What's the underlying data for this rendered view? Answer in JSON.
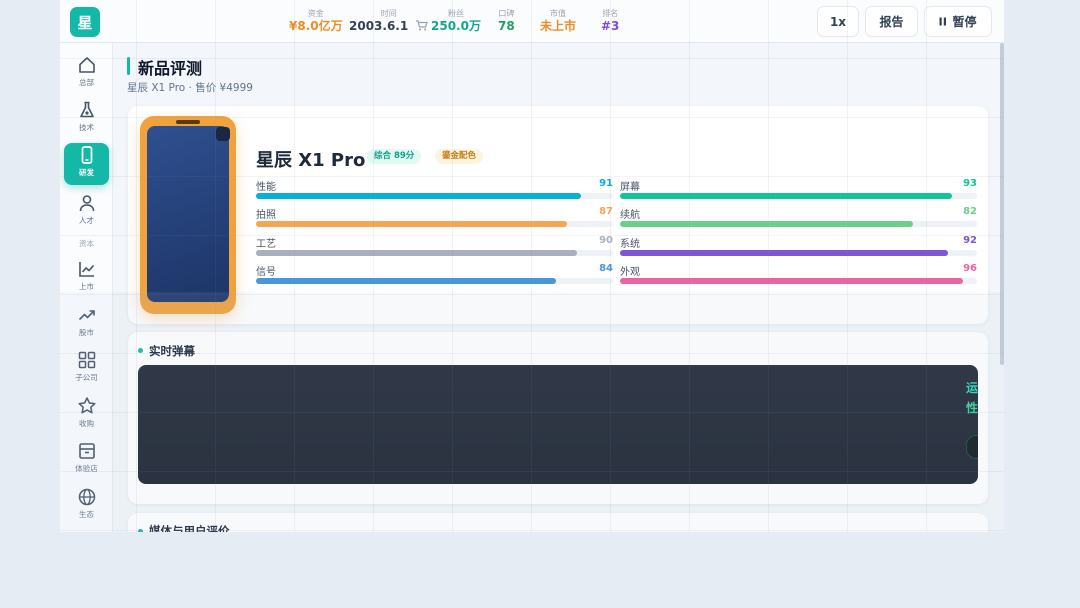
{
  "app": {
    "logo": "星"
  },
  "topbar": {
    "stats": [
      {
        "label": "资金",
        "value": "¥8.0亿万",
        "color": "#f08c24"
      },
      {
        "label": "时间",
        "value": "2003.6.1",
        "color": "#334155"
      },
      {
        "label": "粉丝",
        "value": "250.0万",
        "color": "#14a58f"
      },
      {
        "label": "口碑",
        "value": "78",
        "color": "#22a061"
      },
      {
        "label": "市值",
        "value": "未上市",
        "color": "#f08c24"
      },
      {
        "label": "排名",
        "value": "#3",
        "color": "#7c4ddb"
      }
    ],
    "speed": "1x",
    "report": "报告",
    "pause": "暂停"
  },
  "sidebar": {
    "items": [
      {
        "label": "总部",
        "icon": "home-icon"
      },
      {
        "label": "技术",
        "icon": "flask-icon"
      },
      {
        "label": "研发",
        "icon": "phone-icon",
        "active": true
      },
      {
        "label": "人才",
        "icon": "person-icon"
      },
      {
        "label": "上市",
        "icon": "chart-icon"
      },
      {
        "label": "股市",
        "icon": "trend-icon"
      },
      {
        "label": "子公司",
        "icon": "grid-icon"
      },
      {
        "label": "收购",
        "icon": "star-icon"
      },
      {
        "label": "体验店",
        "icon": "store-icon"
      },
      {
        "label": "生态",
        "icon": "globe-icon"
      }
    ],
    "section": "资本"
  },
  "page": {
    "title": "新品评测",
    "subtitle": "星辰 X1 Pro · 售价 ¥4999"
  },
  "product": {
    "name": "星辰 X1 Pro",
    "score_badge": "综合 89分",
    "color_badge": "鎏金配色",
    "phone_color": "#f0a23e",
    "stats_left": [
      {
        "label": "性能",
        "value": 91,
        "color": "#06b0d8"
      },
      {
        "label": "拍照",
        "value": 87,
        "color": "#f4a653"
      },
      {
        "label": "工艺",
        "value": 90,
        "color": "#a7b0bd"
      },
      {
        "label": "信号",
        "value": 84,
        "color": "#4796de"
      }
    ],
    "stats_right": [
      {
        "label": "屏幕",
        "value": 93,
        "color": "#12c497"
      },
      {
        "label": "续航",
        "value": 82,
        "color": "#6ccf89"
      },
      {
        "label": "系统",
        "value": 92,
        "color": "#7f55d6"
      },
      {
        "label": "外观",
        "value": 96,
        "color": "#ea64a4"
      }
    ]
  },
  "danmaku": {
    "title": "实时弹幕",
    "snippet_a": "运",
    "snippet_b": "性"
  },
  "reviews": {
    "title": "媒体与用户评价"
  }
}
